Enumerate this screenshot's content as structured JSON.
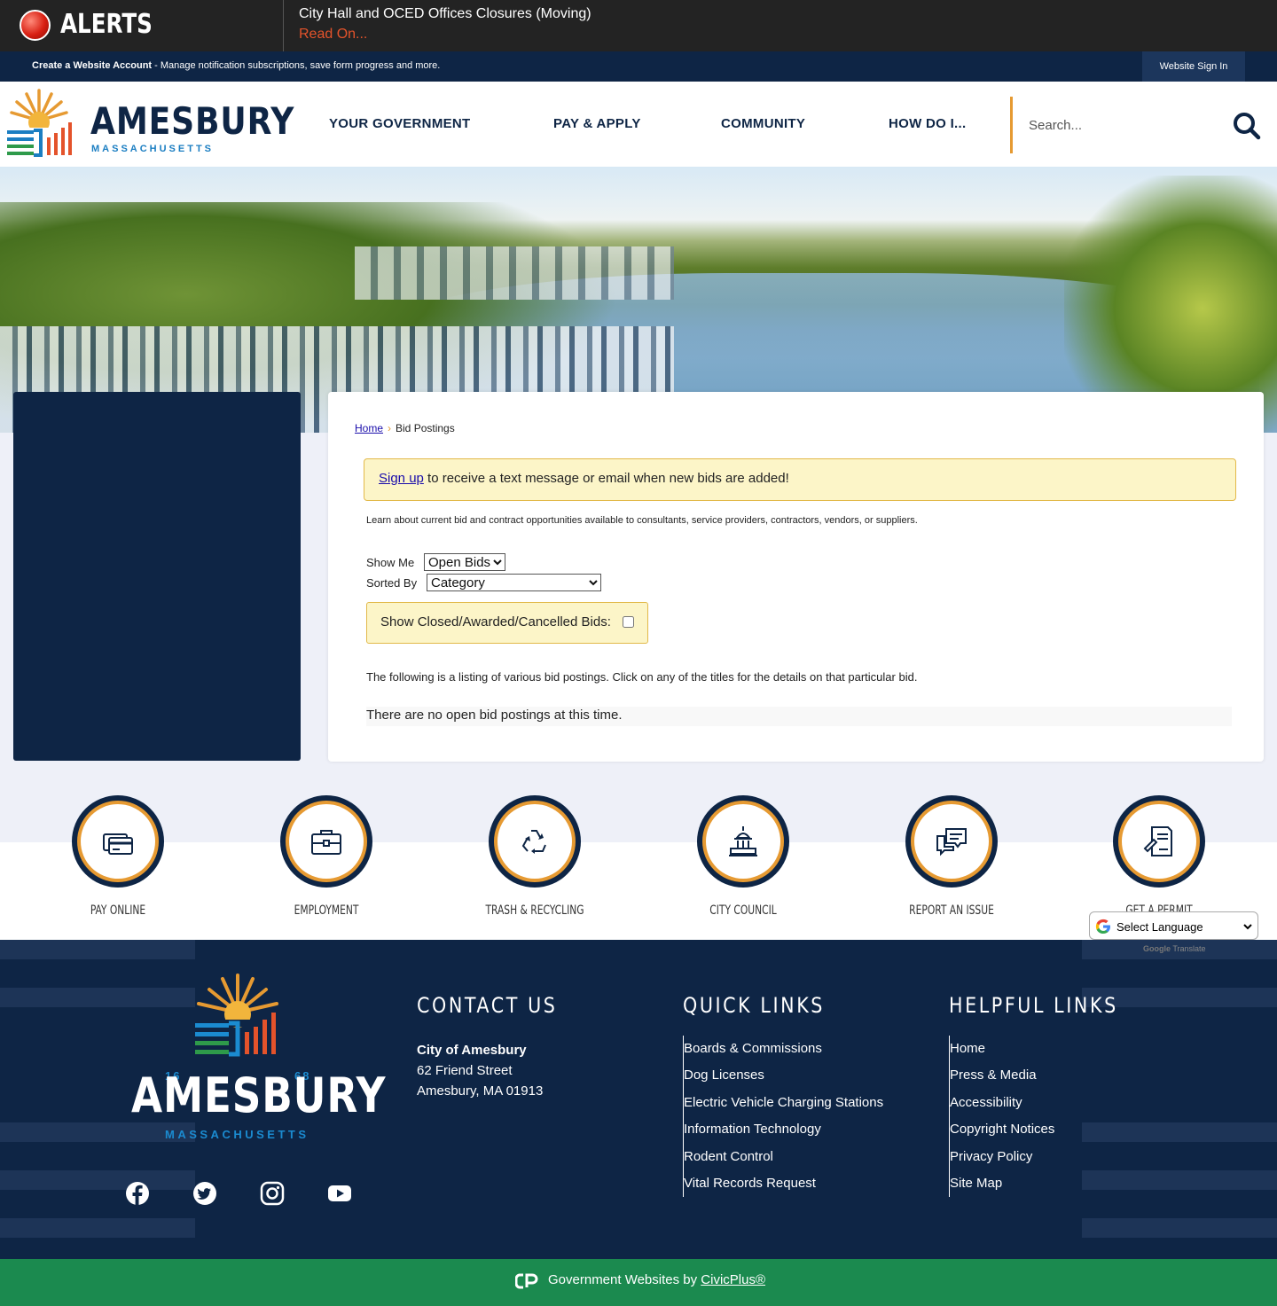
{
  "alerts": {
    "title": "ALERTS",
    "message": "City Hall and OCED Offices Closures (Moving)",
    "link": "Read On..."
  },
  "account_bar": {
    "create_label": "Create a Website Account",
    "create_desc": " - Manage notification subscriptions, save form progress and more.",
    "signin": "Website Sign In"
  },
  "header": {
    "brand": "AMESBURY",
    "sub": "MASSACHUSETTS",
    "nav": [
      "YOUR GOVERNMENT",
      "PAY & APPLY",
      "COMMUNITY",
      "HOW DO I..."
    ],
    "search_placeholder": "Search..."
  },
  "content": {
    "breadcrumb_home": "Home",
    "breadcrumb_current": "Bid Postings",
    "signup_link": "Sign up",
    "signup_text": " to receive a text message or email when new bids are added!",
    "learn_text": "Learn about current bid and contract opportunities available to consultants, service providers, contractors, vendors, or suppliers.",
    "show_me_label": "Show Me",
    "show_me_value": "Open Bids",
    "sorted_by_label": "Sorted By",
    "sorted_by_value": "Category",
    "closed_label": "Show Closed/Awarded/Cancelled Bids:",
    "listing_text": "The following is a listing of various bid postings. Click on any of the titles for the details on that particular bid.",
    "no_posts": "There are no open bid postings at this time."
  },
  "quick_links": [
    {
      "label": "PAY ONLINE",
      "icon": "credit-card-icon"
    },
    {
      "label": "EMPLOYMENT",
      "icon": "briefcase-icon"
    },
    {
      "label": "TRASH & RECYCLING",
      "icon": "recycle-icon"
    },
    {
      "label": "CITY COUNCIL",
      "icon": "capitol-building-icon"
    },
    {
      "label": "REPORT AN ISSUE",
      "icon": "chat-bubbles-icon"
    },
    {
      "label": "GET A PERMIT",
      "icon": "document-signature-icon"
    }
  ],
  "translate": {
    "select_label": "Select Language",
    "powered_by": "Google",
    "powered_suffix": " Translate"
  },
  "footer": {
    "brand": "AMESBURY",
    "sub": "MASSACHUSETTS",
    "year_left": "16",
    "year_right": "68",
    "contact_title": "CONTACT US",
    "contact_name": "City of Amesbury",
    "contact_street": "62 Friend Street",
    "contact_city": "Amesbury, MA 01913",
    "quick_title": "QUICK LINKS",
    "quick_links": [
      "Boards & Commissions",
      "Dog Licenses",
      "Electric Vehicle Charging Stations",
      "Information Technology",
      "Rodent Control",
      "Vital Records Request"
    ],
    "helpful_title": "HELPFUL LINKS",
    "helpful_links": [
      "Home",
      "Press & Media",
      "Accessibility",
      "Copyright Notices",
      "Privacy Policy",
      "Site Map"
    ],
    "social": [
      "facebook-icon",
      "twitter-icon",
      "instagram-icon",
      "youtube-icon"
    ]
  },
  "civic": {
    "text": "Government Websites by ",
    "link": "CivicPlus®"
  },
  "colors": {
    "navy": "#0e2545",
    "orange": "#e69a32",
    "green": "#1b8a4f",
    "alert_red": "#e4532b"
  }
}
